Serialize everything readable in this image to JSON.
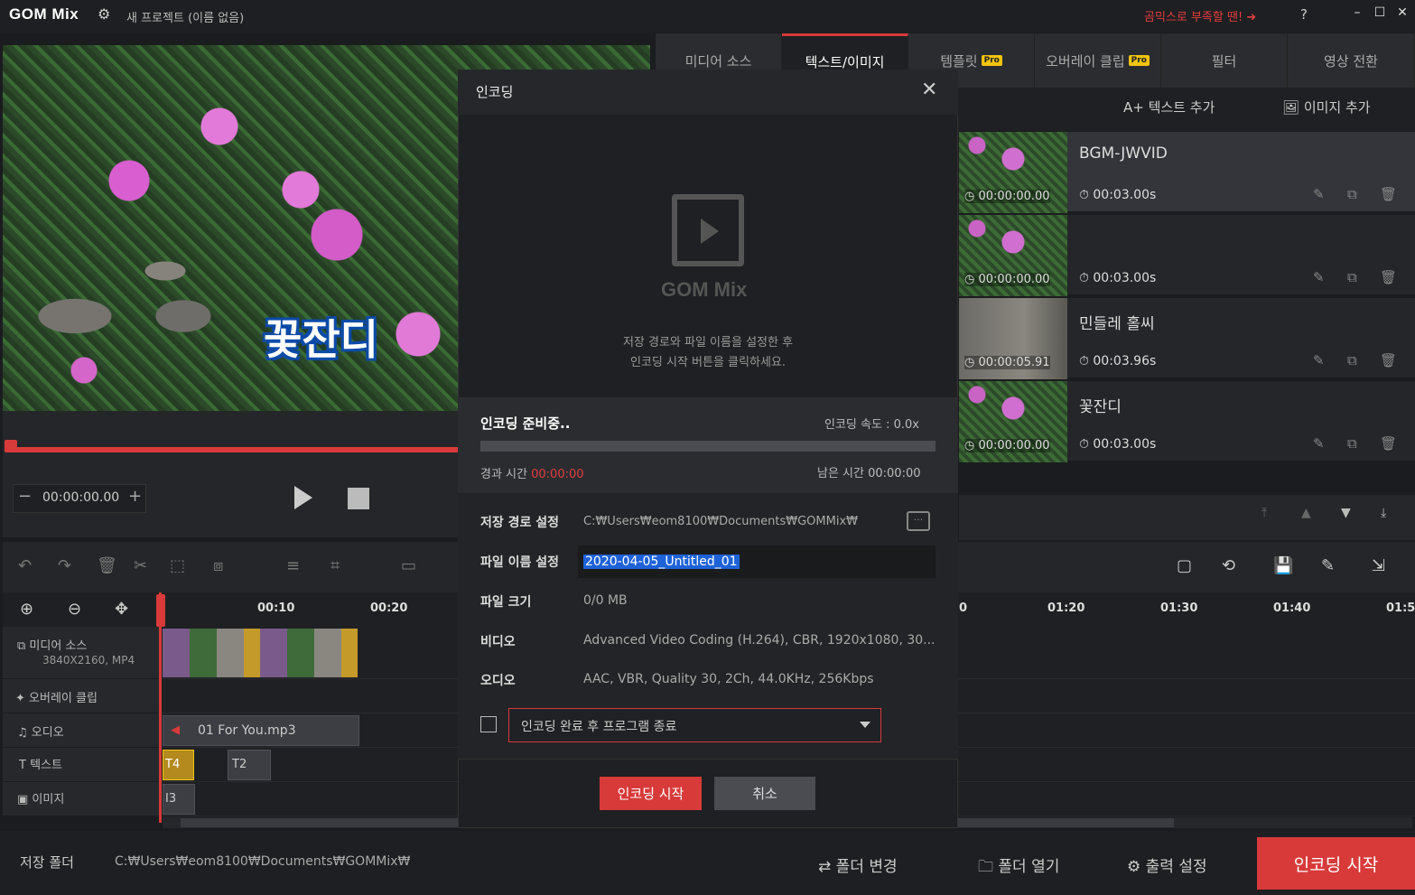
{
  "app": {
    "logo": "GOM Mix",
    "project_title": "새 프로젝트 (이름 없음)",
    "promo": "곰믹스로 부족할 땐! ➜",
    "help": "?"
  },
  "preview": {
    "caption": "꽃잔디",
    "time": "00:00:00.00"
  },
  "tabs": [
    {
      "label": "미디어 소스"
    },
    {
      "label": "텍스트/이미지"
    },
    {
      "label": "템플릿",
      "badge": "Pro"
    },
    {
      "label": "오버레이 클립",
      "badge": "Pro"
    },
    {
      "label": "필터"
    },
    {
      "label": "영상 전환"
    }
  ],
  "subtoolbar": {
    "add_text": "텍스트 추가",
    "add_image": "이미지 추가"
  },
  "items": [
    {
      "title": "BGM-JWVID",
      "start": "00:00:00.00",
      "duration": "00:03.00s"
    },
    {
      "title": "",
      "start": "00:00:00.00",
      "duration": "00:03.00s"
    },
    {
      "title": "민들레 홀씨",
      "start": "00:00:05.91",
      "duration": "00:03.96s"
    },
    {
      "title": "꽃잔디",
      "start": "00:00:00.00",
      "duration": "00:03.00s"
    }
  ],
  "ruler": {
    "left": [
      "00:10",
      "00:20"
    ],
    "right": [
      "0",
      "01:20",
      "01:30",
      "01:40",
      "01:5"
    ]
  },
  "tracks": [
    {
      "label": "미디어 소스",
      "sub": "3840X2160, MP4"
    },
    {
      "label": "오버레이 클립"
    },
    {
      "label": "오디오",
      "clip": "01 For You.mp3"
    },
    {
      "label": "텍스트",
      "clips": [
        "T4",
        "T2"
      ]
    },
    {
      "label": "이미지",
      "clips": [
        "I3"
      ]
    }
  ],
  "bottom": {
    "save_folder_label": "저장 폴더",
    "save_folder_path": "C:₩Users₩eom8100₩Documents₩GOMMix₩",
    "change_folder": "폴더 변경",
    "open_folder": "폴더 열기",
    "output_settings": "출력 설정",
    "encode_start": "인코딩 시작"
  },
  "dialog": {
    "title": "인코딩",
    "logo_text": "GOM Mix",
    "hint_line1": "저장 경로와 파일 이름을 설정한 후",
    "hint_line2": "인코딩 시작 버튼을 클릭하세요.",
    "status": "인코딩 준비중..",
    "speed": "인코딩 속도 : 0.0x",
    "elapsed_label": "경과 시간",
    "elapsed_value": "00:00:00",
    "remaining": "남은 시간 00:00:00",
    "save_path_label": "저장 경로 설정",
    "save_path_value": "C:₩Users₩eom8100₩Documents₩GOMMix₩",
    "filename_label": "파일 이름 설정",
    "filename_value": "2020-04-05_Untitled_01",
    "filesize_label": "파일 크기",
    "filesize_value": "0/0 MB",
    "video_label": "비디오",
    "video_value": "Advanced Video Coding (H.264), CBR, 1920x1080, 30...",
    "audio_label": "오디오",
    "audio_value": "AAC, VBR, Quality 30, 2Ch, 44.0KHz, 256Kbps",
    "exit_option": "인코딩 완료 후 프로그램 종료",
    "start_button": "인코딩 시작",
    "cancel_button": "취소"
  },
  "colors": {
    "accent": "#d83a3a",
    "selection": "#1e62d8"
  }
}
